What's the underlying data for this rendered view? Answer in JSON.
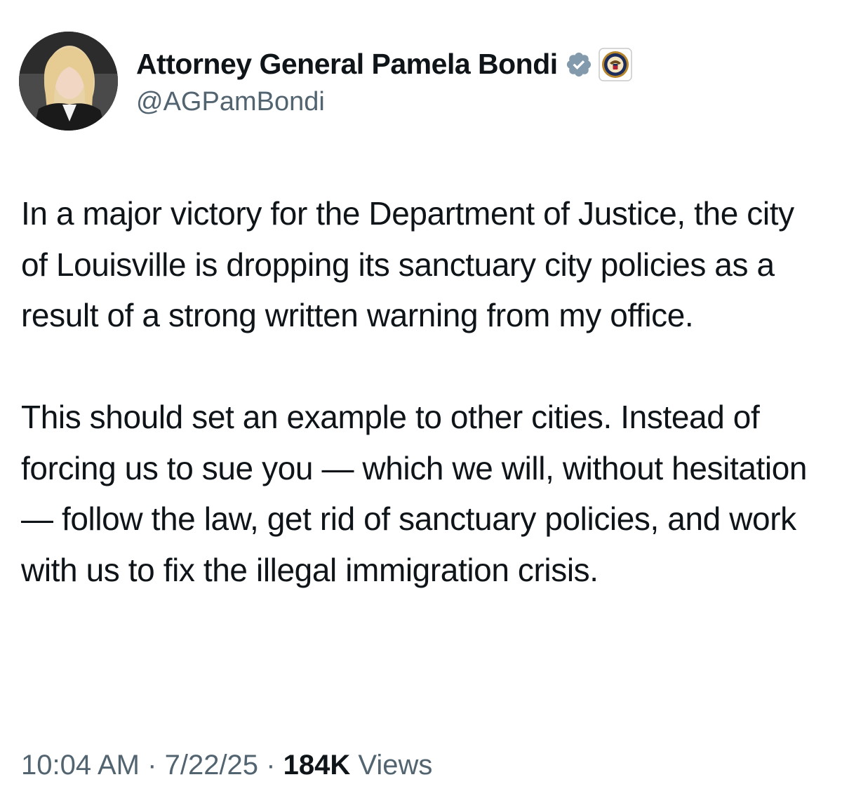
{
  "author": {
    "display_name": "Attorney General Pamela Bondi",
    "handle": "@AGPamBondi",
    "avatar_icon": "profile-photo",
    "verified_icon": "verified-badge-icon",
    "affiliation_icon": "department-of-justice-seal-icon"
  },
  "tweet": {
    "text": "In a major victory for the Department of Justice, the city of Louisville is dropping its sanctuary city policies as a result of a strong written warning from my office.\n\nThis should set an example to other cities. Instead of forcing us to sue you — which we will, without hesitation — follow the law, get rid of sanctuary policies, and work with us to fix the illegal immigration crisis."
  },
  "meta": {
    "time": "10:04 AM",
    "separator": "·",
    "date": "7/22/25",
    "views_count": "184K",
    "views_label": "Views"
  },
  "colors": {
    "text": "#0f1419",
    "secondary": "#536471",
    "verified_badge": "#829aab",
    "background": "#ffffff"
  }
}
